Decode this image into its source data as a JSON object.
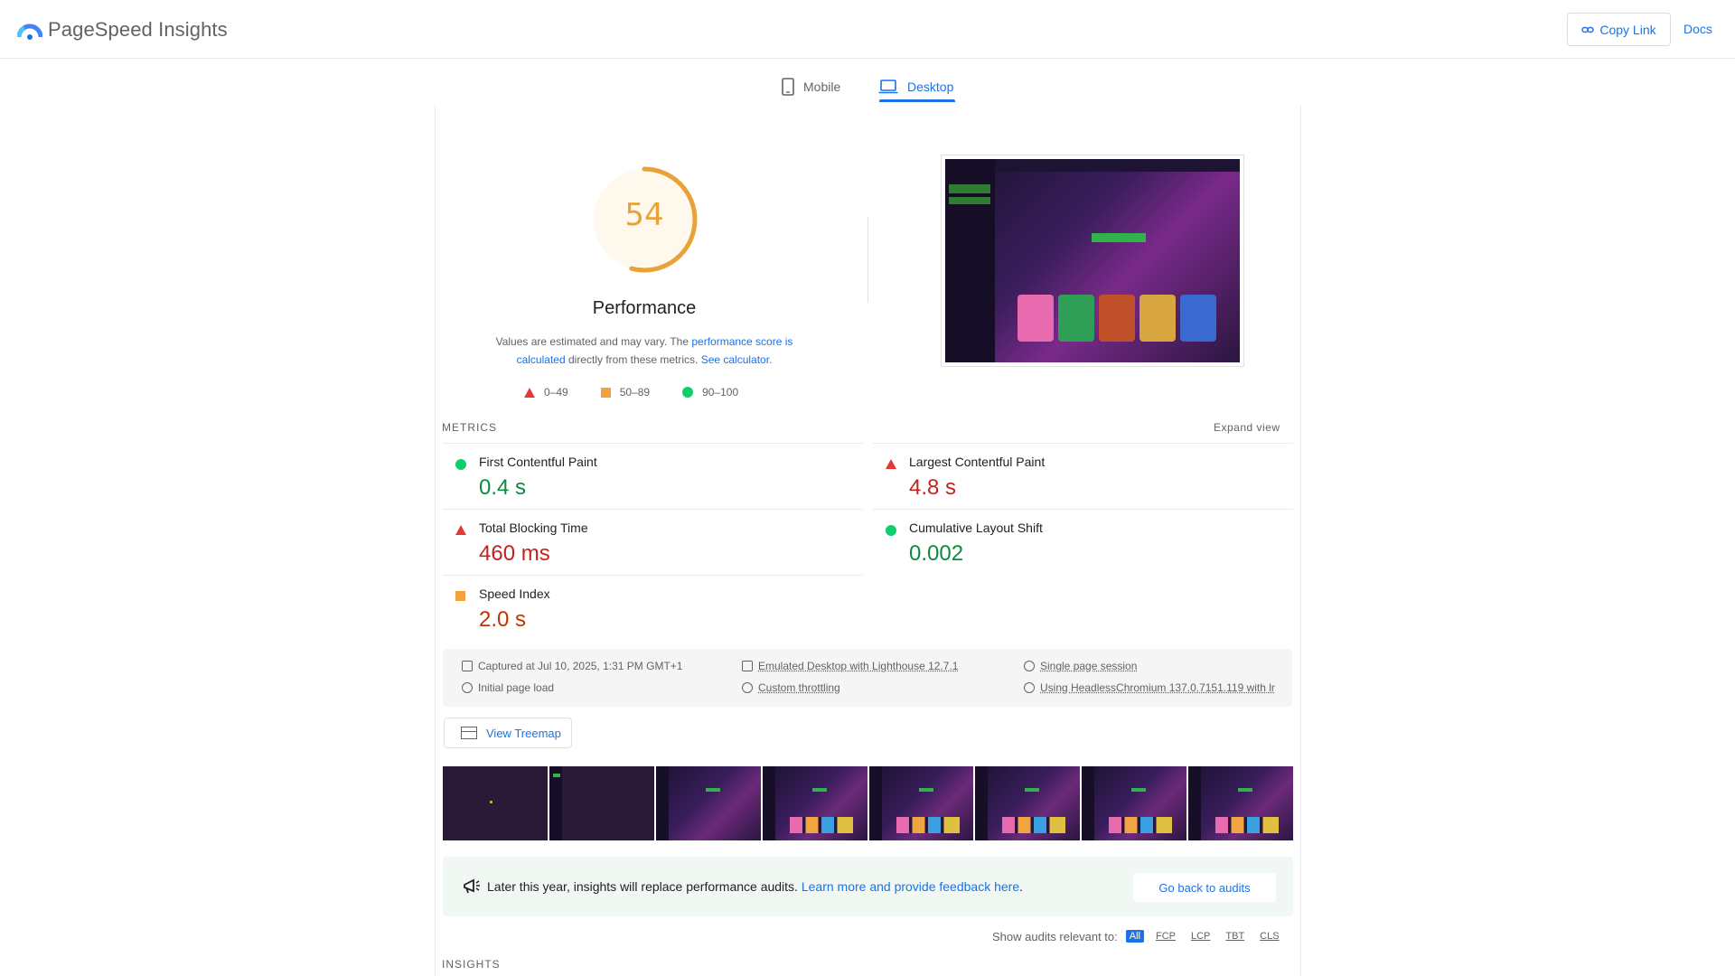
{
  "header": {
    "app_title": "PageSpeed Insights",
    "copy_link_label": "Copy Link",
    "docs_label": "Docs"
  },
  "tabs": [
    {
      "label": "Mobile",
      "icon": "phone-icon",
      "selected": false
    },
    {
      "label": "Desktop",
      "icon": "laptop-icon",
      "selected": true
    }
  ],
  "performance": {
    "score": "54",
    "score_fraction": 0.54,
    "title": "Performance",
    "desc_pre": "Values are estimated and may vary. The ",
    "desc_link1": "performance score is calculated",
    "desc_mid": " directly from these metrics. ",
    "desc_link2": "See calculator.",
    "legend": [
      "0–49",
      "50–89",
      "90–100"
    ],
    "accent_color": "#e8a23a"
  },
  "metrics": {
    "section_label": "METRICS",
    "expand_label": "Expand view",
    "items": [
      {
        "label": "First Contentful Paint",
        "value": "0.4 s",
        "rating": "good"
      },
      {
        "label": "Largest Contentful Paint",
        "value": "4.8 s",
        "rating": "bad"
      },
      {
        "label": "Total Blocking Time",
        "value": "460 ms",
        "rating": "bad"
      },
      {
        "label": "Cumulative Layout Shift",
        "value": "0.002",
        "rating": "good"
      },
      {
        "label": "Speed Index",
        "value": "2.0 s",
        "rating": "average"
      }
    ]
  },
  "runtime": {
    "captured": "Captured at Jul 10, 2025, 1:31 PM GMT+1",
    "initial_load": "Initial page load",
    "emulated": "Emulated Desktop with Lighthouse 12.7.1",
    "throttling": "Custom throttling",
    "session": "Single page session",
    "browser": "Using HeadlessChromium 137.0.7151.119 with lr"
  },
  "treemap_label": "View Treemap",
  "notice": {
    "text": "Later this year, insights will replace performance audits. ",
    "link": "Learn more and provide feedback here",
    "text_end": ".",
    "button": "Go back to audits"
  },
  "audit_filter": {
    "label": "Show audits relevant to:",
    "options": [
      "All",
      "FCP",
      "LCP",
      "TBT",
      "CLS"
    ]
  },
  "insights_label": "INSIGHTS"
}
